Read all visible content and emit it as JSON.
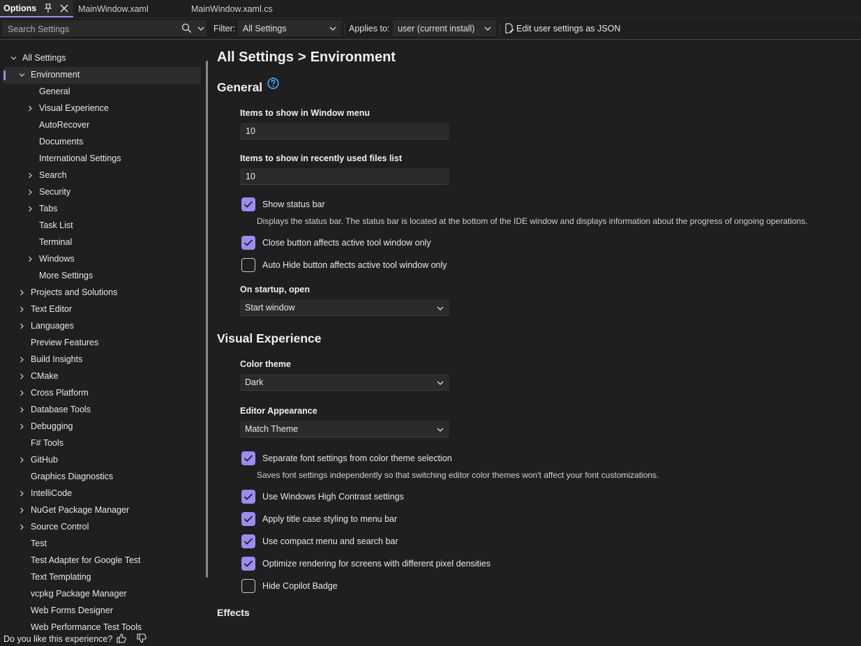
{
  "tabs": [
    {
      "label": "Options"
    },
    {
      "label": "MainWindow.xaml"
    },
    {
      "label": "MainWindow.xaml.cs"
    }
  ],
  "toolbar": {
    "search_placeholder": "Search Settings",
    "filter_label": "Filter:",
    "filter_value": "All Settings",
    "applies_label": "Applies to:",
    "applies_value": "user (current install)",
    "json_button": "Edit user settings as JSON"
  },
  "sidebar": {
    "items": [
      {
        "label": "All Settings",
        "expanded": true
      },
      {
        "label": "Environment",
        "expanded": true,
        "selected": true
      },
      {
        "label": "General"
      },
      {
        "label": "Visual Experience"
      },
      {
        "label": "AutoRecover"
      },
      {
        "label": "Documents"
      },
      {
        "label": "International Settings"
      },
      {
        "label": "Search"
      },
      {
        "label": "Security"
      },
      {
        "label": "Tabs"
      },
      {
        "label": "Task List"
      },
      {
        "label": "Terminal"
      },
      {
        "label": "Windows"
      },
      {
        "label": "More Settings"
      },
      {
        "label": "Projects and Solutions"
      },
      {
        "label": "Text Editor"
      },
      {
        "label": "Languages"
      },
      {
        "label": "Preview Features"
      },
      {
        "label": "Build Insights"
      },
      {
        "label": "CMake"
      },
      {
        "label": "Cross Platform"
      },
      {
        "label": "Database Tools"
      },
      {
        "label": "Debugging"
      },
      {
        "label": "F# Tools"
      },
      {
        "label": "GitHub"
      },
      {
        "label": "Graphics Diagnostics"
      },
      {
        "label": "IntelliCode"
      },
      {
        "label": "NuGet Package Manager"
      },
      {
        "label": "Source Control"
      },
      {
        "label": "Test"
      },
      {
        "label": "Test Adapter for Google Test"
      },
      {
        "label": "Text Templating"
      },
      {
        "label": "vcpkg Package Manager"
      },
      {
        "label": "Web Forms Designer"
      },
      {
        "label": "Web Performance Test Tools"
      }
    ]
  },
  "feedback": {
    "question": "Do you like this experience?"
  },
  "main": {
    "breadcrumb_root": "All Settings",
    "breadcrumb_sep": ">",
    "breadcrumb_current": "Environment",
    "general": {
      "title": "General",
      "window_menu_label": "Items to show in Window menu",
      "window_menu_value": "10",
      "recent_files_label": "Items to show in recently used files list",
      "recent_files_value": "10",
      "show_status_bar": {
        "label": "Show status bar",
        "checked": true
      },
      "status_bar_desc": "Displays the status bar. The status bar is located at the bottom of the IDE window and displays information about the progress of ongoing operations.",
      "close_button": {
        "label": "Close button affects active tool window only",
        "checked": true
      },
      "auto_hide": {
        "label": "Auto Hide button affects active tool window only",
        "checked": false
      },
      "startup_label": "On startup, open",
      "startup_value": "Start window"
    },
    "visual": {
      "title": "Visual Experience",
      "theme_label": "Color theme",
      "theme_value": "Dark",
      "editor_label": "Editor Appearance",
      "editor_value": "Match Theme",
      "separate_font": {
        "label": "Separate font settings from color theme selection",
        "checked": true
      },
      "separate_font_desc": "Saves font settings independently so that switching editor color themes won't affect your font customizations.",
      "high_contrast": {
        "label": "Use Windows High Contrast settings",
        "checked": true
      },
      "title_case": {
        "label": "Apply title case styling to menu bar",
        "checked": true
      },
      "compact_menu": {
        "label": "Use compact menu and search bar",
        "checked": true
      },
      "optimize_render": {
        "label": "Optimize rendering for screens with different pixel densities",
        "checked": true
      },
      "hide_copilot": {
        "label": "Hide Copilot Badge",
        "checked": false
      }
    },
    "effects_title": "Effects"
  },
  "colors": {
    "accent": "#9d8bf0",
    "background": "#1f1f1f",
    "input_bg": "#2b2b2b"
  }
}
